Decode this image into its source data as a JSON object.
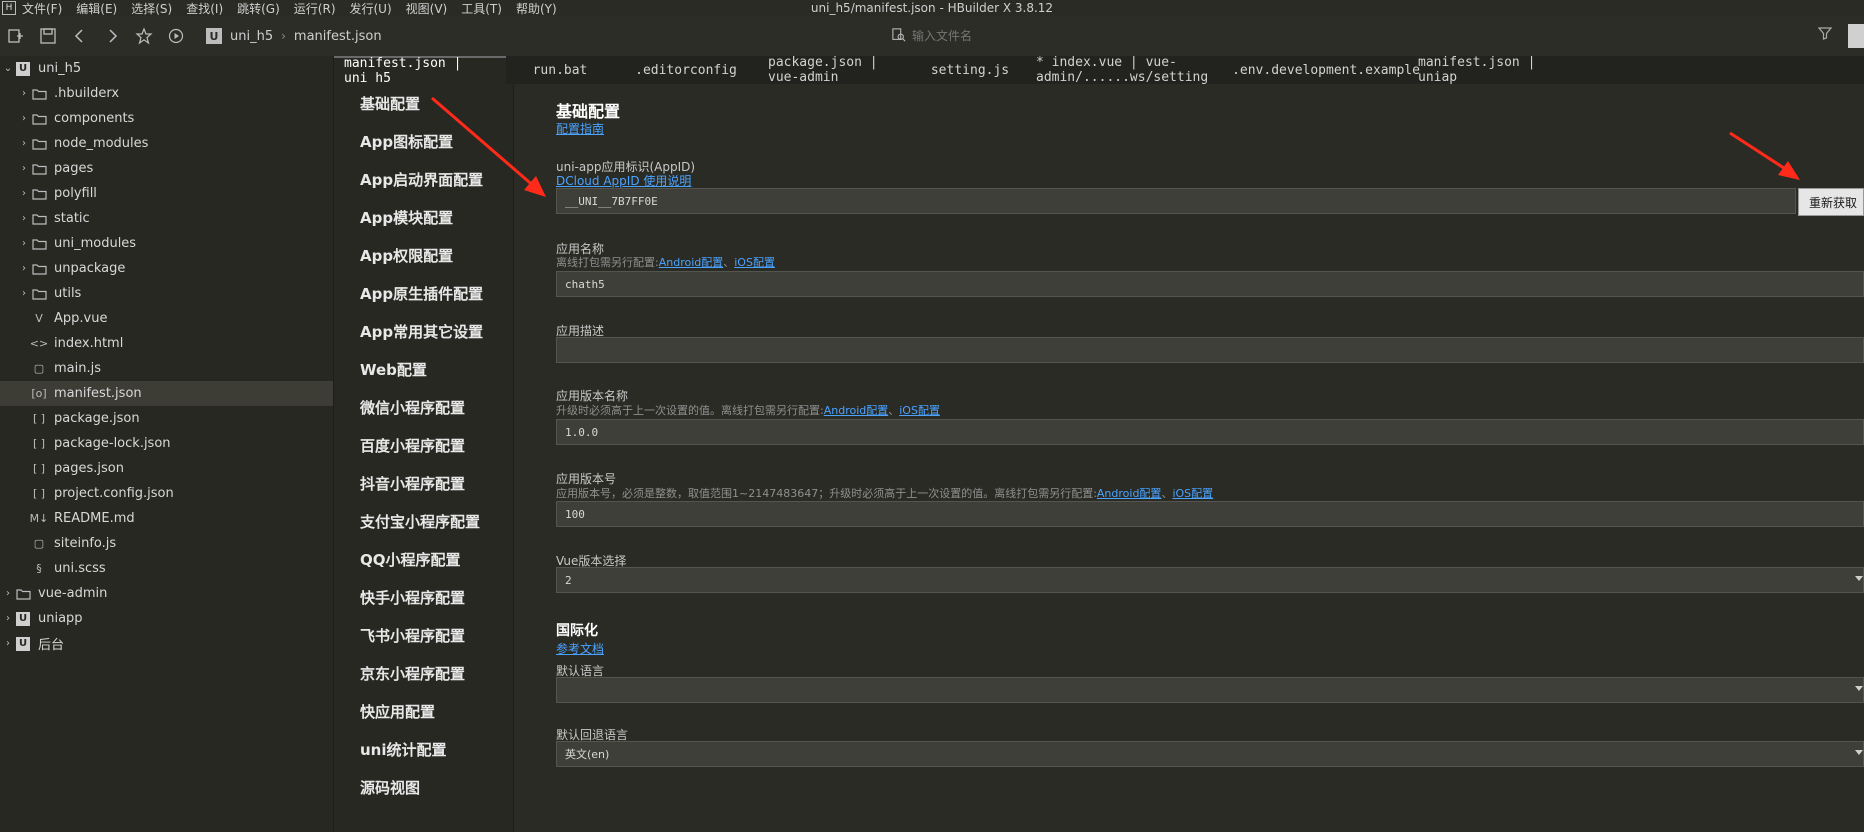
{
  "menubar": {
    "items": [
      "文件(F)",
      "编辑(E)",
      "选择(S)",
      "查找(I)",
      "跳转(G)",
      "运行(R)",
      "发行(U)",
      "视图(V)",
      "工具(T)",
      "帮助(Y)"
    ],
    "window_title": "uni_h5/manifest.json - HBuilder X 3.8.12"
  },
  "toolbar": {
    "breadcrumb": {
      "project": "uni_h5",
      "file": "manifest.json"
    },
    "search_placeholder": "输入文件名"
  },
  "sidebar": {
    "items": [
      {
        "label": "uni_h5",
        "level": 0,
        "type": "project",
        "expanded": true
      },
      {
        "label": ".hbuilderx",
        "level": 1,
        "type": "folder"
      },
      {
        "label": "components",
        "level": 1,
        "type": "folder"
      },
      {
        "label": "node_modules",
        "level": 1,
        "type": "folder"
      },
      {
        "label": "pages",
        "level": 1,
        "type": "folder"
      },
      {
        "label": "polyfill",
        "level": 1,
        "type": "folder"
      },
      {
        "label": "static",
        "level": 1,
        "type": "folder"
      },
      {
        "label": "uni_modules",
        "level": 1,
        "type": "folder"
      },
      {
        "label": "unpackage",
        "level": 1,
        "type": "folder"
      },
      {
        "label": "utils",
        "level": 1,
        "type": "folder"
      },
      {
        "label": "App.vue",
        "level": 1,
        "type": "file",
        "glyph": "V"
      },
      {
        "label": "index.html",
        "level": 1,
        "type": "file",
        "glyph": "<>"
      },
      {
        "label": "main.js",
        "level": 1,
        "type": "file",
        "glyph": "▢"
      },
      {
        "label": "manifest.json",
        "level": 1,
        "type": "file",
        "glyph": "[o]",
        "selected": true
      },
      {
        "label": "package.json",
        "level": 1,
        "type": "file",
        "glyph": "[ ]"
      },
      {
        "label": "package-lock.json",
        "level": 1,
        "type": "file",
        "glyph": "[ ]"
      },
      {
        "label": "pages.json",
        "level": 1,
        "type": "file",
        "glyph": "[ ]"
      },
      {
        "label": "project.config.json",
        "level": 1,
        "type": "file",
        "glyph": "[ ]"
      },
      {
        "label": "README.md",
        "level": 1,
        "type": "file",
        "glyph": "M↓"
      },
      {
        "label": "siteinfo.js",
        "level": 1,
        "type": "file",
        "glyph": "▢"
      },
      {
        "label": "uni.scss",
        "level": 1,
        "type": "file",
        "glyph": "§"
      },
      {
        "label": "vue-admin",
        "level": 0,
        "type": "folder"
      },
      {
        "label": "uniapp",
        "level": 0,
        "type": "project"
      },
      {
        "label": "后台",
        "level": 0,
        "type": "project"
      }
    ]
  },
  "tabs": [
    {
      "label": "manifest.json | uni_h5",
      "active": true
    },
    {
      "label": "run.bat"
    },
    {
      "label": ".editorconfig"
    },
    {
      "label": "package.json | vue-admin"
    },
    {
      "label": "setting.js"
    },
    {
      "label": "* index.vue | vue-admin/......ws/setting"
    },
    {
      "label": ".env.development.example"
    },
    {
      "label": "manifest.json | uniap"
    }
  ],
  "settings_nav": [
    "基础配置",
    "App图标配置",
    "App启动界面配置",
    "App模块配置",
    "App权限配置",
    "App原生插件配置",
    "App常用其它设置",
    "Web配置",
    "微信小程序配置",
    "百度小程序配置",
    "抖音小程序配置",
    "支付宝小程序配置",
    "QQ小程序配置",
    "快手小程序配置",
    "飞书小程序配置",
    "京东小程序配置",
    "快应用配置",
    "uni统计配置",
    "源码视图"
  ],
  "content": {
    "title": "基础配置",
    "guide_link": "配置指南",
    "appid": {
      "label": "uni-app应用标识(AppID)",
      "link": "DCloud AppID 使用说明",
      "value": "__UNI__7B7FF0E",
      "button": "重新获取"
    },
    "app_name": {
      "label": "应用名称",
      "hint": "离线打包需另行配置:",
      "link_android": "Android配置",
      "sep": "、",
      "link_ios": "iOS配置",
      "value": "chath5"
    },
    "app_desc": {
      "label": "应用描述",
      "value": ""
    },
    "version_name": {
      "label": "应用版本名称",
      "hint": "升级时必须高于上一次设置的值。离线打包需另行配置:",
      "link_android": "Android配置",
      "sep": "、",
      "link_ios": "iOS配置",
      "value": "1.0.0"
    },
    "version_code": {
      "label": "应用版本号",
      "hint": "应用版本号，必须是整数，取值范围1~2147483647；升级时必须高于上一次设置的值。离线打包需另行配置:",
      "link_android": "Android配置",
      "sep": "、",
      "link_ios": "iOS配置",
      "value": "100"
    },
    "vue_version": {
      "label": "Vue版本选择",
      "value": "2"
    },
    "i18n": {
      "title": "国际化",
      "link": "参考文档",
      "default_lang_label": "默认语言",
      "default_lang_value": "",
      "fallback_lang_label": "默认回退语言",
      "fallback_lang_value": "英文(en)"
    }
  },
  "colors": {
    "background": "#272822",
    "content_bg": "#2b2b26",
    "link": "#4aa3ff",
    "annotation_arrow": "#ff2a1a"
  }
}
